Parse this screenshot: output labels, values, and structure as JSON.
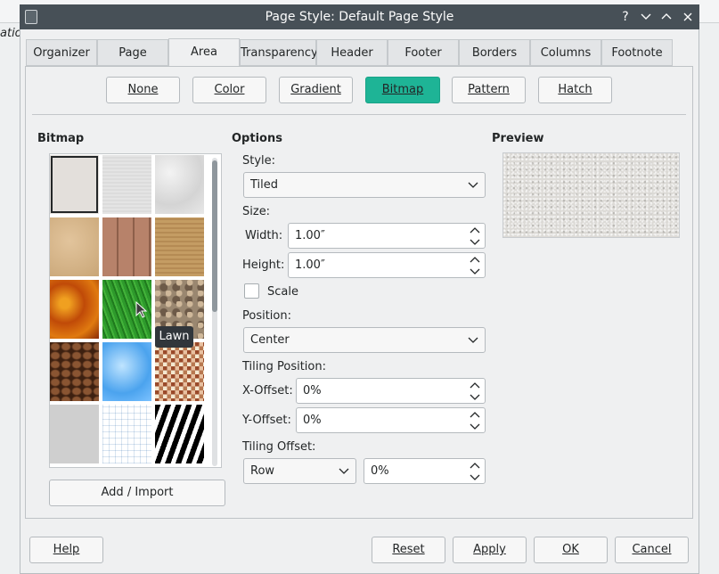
{
  "window": {
    "title": "Page Style: Default Page Style"
  },
  "background_app": {
    "partial_text": "ation"
  },
  "tabs": [
    {
      "label": "Organizer",
      "active": false
    },
    {
      "label": "Page",
      "active": false
    },
    {
      "label": "Area",
      "active": true
    },
    {
      "label": "Transparency",
      "active": false
    },
    {
      "label": "Header",
      "active": false
    },
    {
      "label": "Footer",
      "active": false
    },
    {
      "label": "Borders",
      "active": false
    },
    {
      "label": "Columns",
      "active": false
    },
    {
      "label": "Footnote",
      "active": false
    }
  ],
  "fill_types": [
    {
      "label": "None",
      "selected": false
    },
    {
      "label": "Color",
      "selected": false
    },
    {
      "label": "Gradient",
      "selected": false
    },
    {
      "label": "Bitmap",
      "selected": true
    },
    {
      "label": "Pattern",
      "selected": false
    },
    {
      "label": "Hatch",
      "selected": false
    }
  ],
  "bitmap": {
    "heading": "Bitmap",
    "tiles": [
      {
        "icon": "painted-white-icon",
        "selected": true
      },
      {
        "icon": "paper-texture-icon",
        "selected": false
      },
      {
        "icon": "paper-crumpled-icon",
        "selected": false
      },
      {
        "icon": "parchment-icon",
        "selected": false
      },
      {
        "icon": "fence-icon",
        "selected": false
      },
      {
        "icon": "stone-icon",
        "selected": false
      },
      {
        "icon": "autumn-leaves-icon",
        "selected": false
      },
      {
        "icon": "lawn-icon",
        "selected": false
      },
      {
        "icon": "pebbles-icon",
        "selected": false
      },
      {
        "icon": "coffee-beans-icon",
        "selected": false
      },
      {
        "icon": "sky-icon",
        "selected": false
      },
      {
        "icon": "color-stripes-icon",
        "selected": false
      },
      {
        "icon": "concrete-icon",
        "selected": false
      },
      {
        "icon": "graph-paper-icon",
        "selected": false
      },
      {
        "icon": "zebra-icon",
        "selected": false
      }
    ],
    "hover_tooltip": "Lawn",
    "add_button": "Add / Import"
  },
  "options": {
    "heading": "Options",
    "style_label": "Style:",
    "style_value": "Tiled",
    "size_label": "Size:",
    "width_label": "Width:",
    "width_value": "1.00″",
    "height_label": "Height:",
    "height_value": "1.00″",
    "scale_label": "Scale",
    "scale_checked": false,
    "position_label": "Position:",
    "position_value": "Center",
    "tiling_position_label": "Tiling Position:",
    "x_offset_label": "X-Offset:",
    "x_offset_value": "0%",
    "y_offset_label": "Y-Offset:",
    "y_offset_value": "0%",
    "tiling_offset_label": "Tiling Offset:",
    "tiling_offset_mode": "Row",
    "tiling_offset_value": "0%"
  },
  "preview": {
    "heading": "Preview"
  },
  "footer": {
    "help": "Help",
    "reset": "Reset",
    "apply": "Apply",
    "ok": "OK",
    "cancel": "Cancel"
  },
  "colors": {
    "accent": "#1eb496",
    "titlebar": "#475057",
    "dialog_bg": "#eff0f1"
  }
}
